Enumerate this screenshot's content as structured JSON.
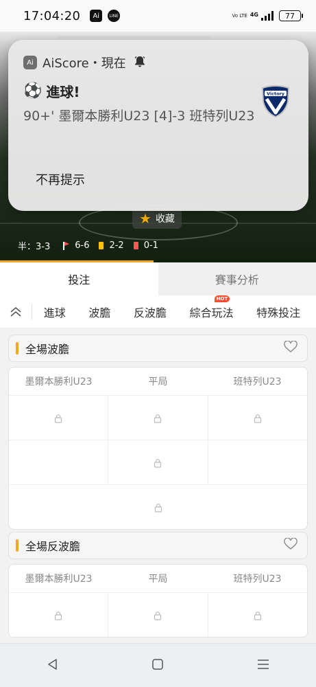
{
  "status_bar": {
    "time": "17:04:20",
    "app_icons": [
      {
        "name": "aiscore-app-icon",
        "glyph": "Ai"
      },
      {
        "name": "line-app-icon",
        "glyph": "LINE"
      }
    ],
    "volte": "Vo LTE",
    "network": "4G",
    "battery": "77"
  },
  "notification": {
    "app_icon": "Ai",
    "app_name": "AiScore・現在",
    "title": "進球!",
    "body": "90+' 墨爾本勝利U23 [4]-3 班特列U23",
    "action": "不再提示",
    "logo_text": "Victory"
  },
  "hero": {
    "favorite_label": "收藏",
    "half_time": "半：3-3",
    "corners": "6-6",
    "yellow_cards": "2-2",
    "red_cards": "0-1",
    "colors": {
      "accent": "#f5a623",
      "star": "#f5b000",
      "yellow": "#ffc107",
      "red": "#ff5757"
    }
  },
  "main_tabs": [
    {
      "label": "投注",
      "active": true
    },
    {
      "label": "賽事分析",
      "active": false
    }
  ],
  "sub_tabs": [
    {
      "label": "進球"
    },
    {
      "label": "波膽"
    },
    {
      "label": "反波膽"
    },
    {
      "label": "綜合玩法",
      "badge": "HOT"
    },
    {
      "label": "特殊投注"
    }
  ],
  "sections": [
    {
      "title": "全場波膽",
      "columns": [
        "墨爾本勝利U23",
        "平局",
        "班特列U23"
      ],
      "rows": [
        [
          "locked",
          "locked",
          "locked"
        ],
        [
          "",
          "locked",
          ""
        ],
        [
          "locked"
        ]
      ]
    },
    {
      "title": "全場反波膽",
      "columns": [
        "墨爾本勝利U23",
        "平局",
        "班特列U23"
      ],
      "rows": [
        [
          "locked",
          "locked",
          "locked"
        ]
      ]
    }
  ],
  "nav_bar": {
    "icons": [
      "back-icon",
      "home-icon",
      "recents-icon"
    ]
  }
}
